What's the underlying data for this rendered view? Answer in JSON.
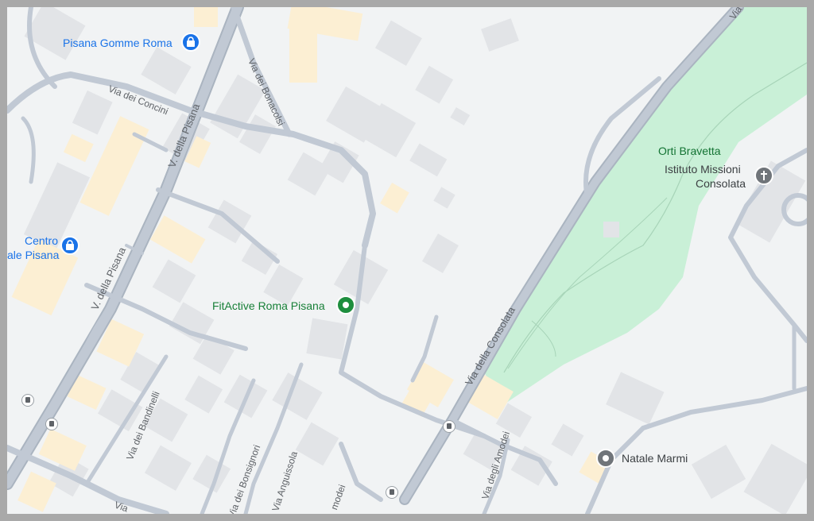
{
  "colors": {
    "land": "#f1f3f4",
    "road": "#c1c9d4",
    "road_outline": "#aab4c0",
    "building": "#e2e4e7",
    "building_warm": "#fcefd3",
    "park": "#c9f0d7",
    "park_path": "#9fd0b2",
    "lodging_blue": "#1a73e8",
    "gym_green": "#1e8e3e",
    "place_gray": "#5f6368"
  },
  "streets": {
    "via_dei_concini": "Via dei Concini",
    "via_dei_bonacolsi": "Via dei Bonacolsi",
    "v_della_pisana_top": "V. della Pisana",
    "v_della_pisana_mid": "V. della Pisana",
    "via_della_consolata_top": "Via",
    "via_della_consolata": "Via della Consolata",
    "via_dei_bandinelli": "Via dei Bandinelli",
    "via_dei_bonsignori": "Via dei Bonsignori",
    "via_anguissola": "Via Anguissola",
    "via_degli_amodei": "Via degli Amodei",
    "via_amodei_short": "modei",
    "via_bottom_left": "Via"
  },
  "places": {
    "pisana_gomme": {
      "name": "Pisana Gomme Roma",
      "icon": "shopping-bag-icon"
    },
    "centro_pisana": {
      "line1": "Centro",
      "line2": "ale Pisana",
      "icon": "shopping-bag-icon"
    },
    "fitactive": {
      "name": "FitActive Roma Pisana",
      "icon": "gym-pin-icon"
    },
    "orti_bravetta": {
      "name": "Orti Bravetta"
    },
    "istituto": {
      "line1": "Istituto Missioni",
      "line2": "Consolata",
      "icon": "church-cross-icon"
    },
    "natale_marmi": {
      "name": "Natale Marmi",
      "icon": "place-pin-icon"
    }
  },
  "transit": {
    "icon": "bus-stop-icon"
  }
}
